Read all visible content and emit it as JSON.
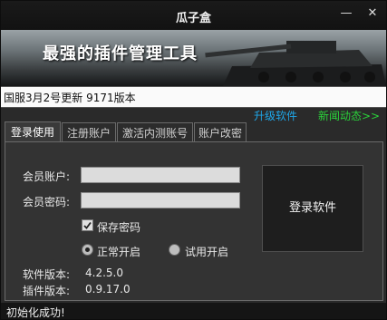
{
  "window": {
    "title": "瓜子盒",
    "minimize": "—",
    "close": "✕"
  },
  "banner": {
    "headline": "最强的插件管理工具"
  },
  "info": {
    "text": "国服3月2号更新  9171版本"
  },
  "links": {
    "upgrade": "升级软件",
    "news": "新闻动态>>"
  },
  "tabs": [
    "登录使用",
    "注册账户",
    "激活内测账号",
    "账户改密"
  ],
  "form": {
    "account_label": "会员账户:",
    "password_label": "会员密码:",
    "account_value": "",
    "password_value": "",
    "save_password_label": "保存密码",
    "mode_normal_label": "正常开启",
    "mode_trial_label": "试用开启",
    "login_button": "登录软件"
  },
  "versions": {
    "software_label": "软件版本:",
    "software_value": "4.2.5.0",
    "plugin_label": "插件版本:",
    "plugin_value": "0.9.17.0"
  },
  "status": {
    "text": "初始化成功!"
  },
  "colors": {
    "link_blue": "#1fa6e8",
    "link_green": "#2ad13a",
    "background": "#2a2a2a",
    "accent": "#dcdcdc"
  },
  "state": {
    "save_password_checked": true,
    "selected_mode": "normal"
  }
}
